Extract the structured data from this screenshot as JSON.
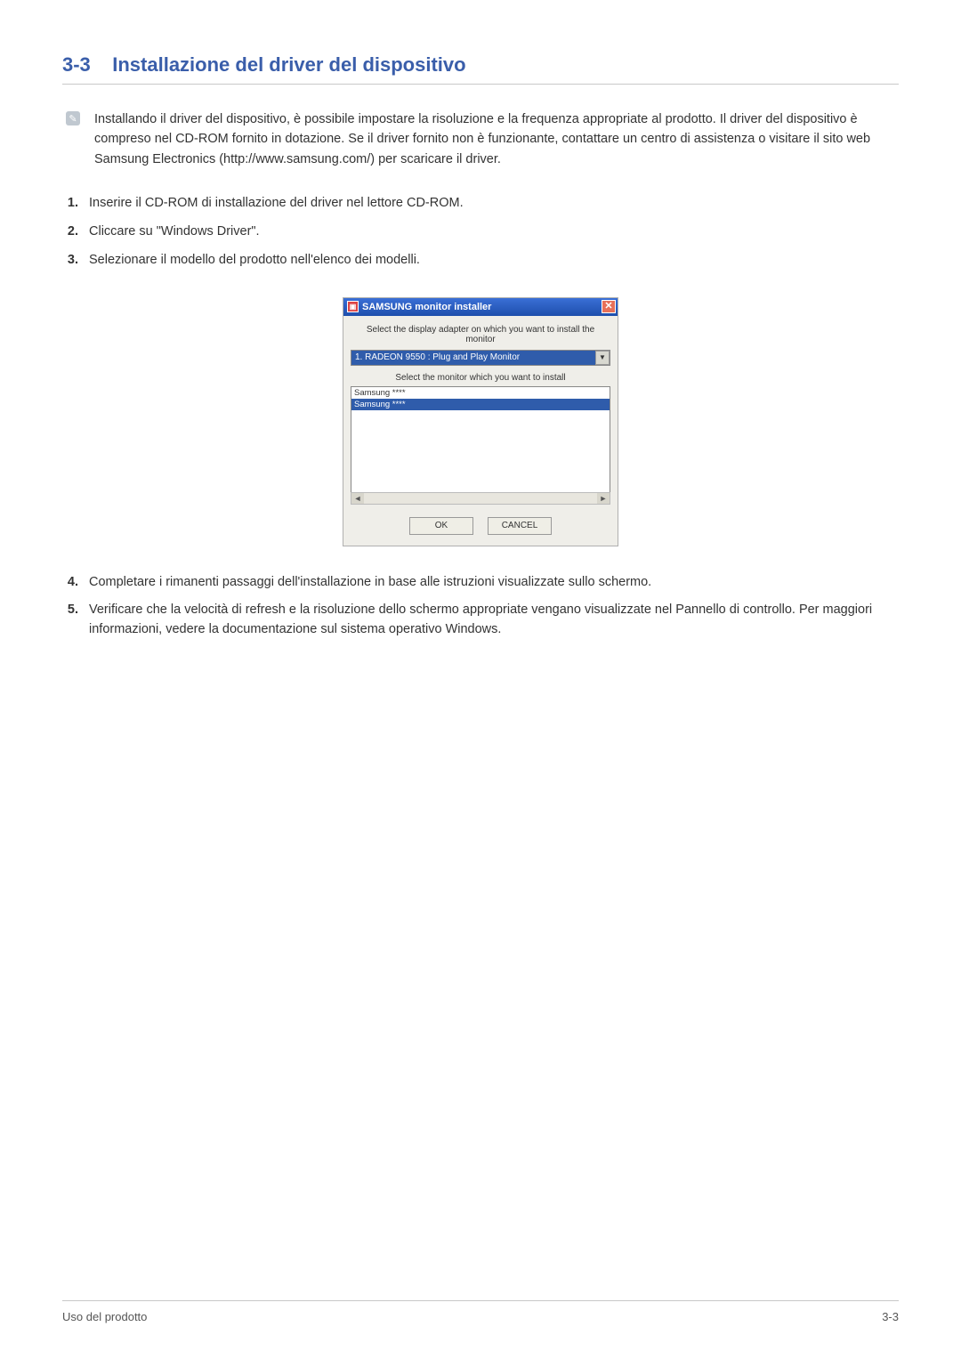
{
  "heading": {
    "number": "3-3",
    "title": "Installazione del driver del dispositivo"
  },
  "info": {
    "text": "Installando il driver del dispositivo, è possibile impostare la risoluzione e la frequenza appropriate al prodotto. Il driver del dispositivo è compreso nel CD-ROM fornito in dotazione. Se il driver fornito non è funzionante, contattare un centro di assistenza o visitare il sito web Samsung Electronics (http://www.samsung.com/) per scaricare il driver."
  },
  "steps": [
    "Inserire il CD-ROM di installazione del driver nel lettore CD-ROM.",
    "Cliccare su \"Windows Driver\".",
    "Selezionare il modello del prodotto nell'elenco dei modelli.",
    "Completare i rimanenti passaggi dell'installazione in base alle istruzioni visualizzate sullo schermo.",
    "Verificare che la velocità di refresh e la risoluzione dello schermo appropriate vengano visualizzate nel Pannello di controllo. Per maggiori informazioni, vedere la documentazione sul sistema operativo Windows."
  ],
  "dialog": {
    "title": "SAMSUNG monitor installer",
    "label_adapter": "Select the display adapter on which you want to install the monitor",
    "adapter_selected": "1. RADEON 9550 : Plug and Play Monitor",
    "label_monitor": "Select the monitor which you want to install",
    "list_items": [
      "Samsung ****",
      "Samsung ****"
    ],
    "ok": "OK",
    "cancel": "CANCEL",
    "close": "✕"
  },
  "footer": {
    "left": "Uso del prodotto",
    "right": "3-3"
  }
}
